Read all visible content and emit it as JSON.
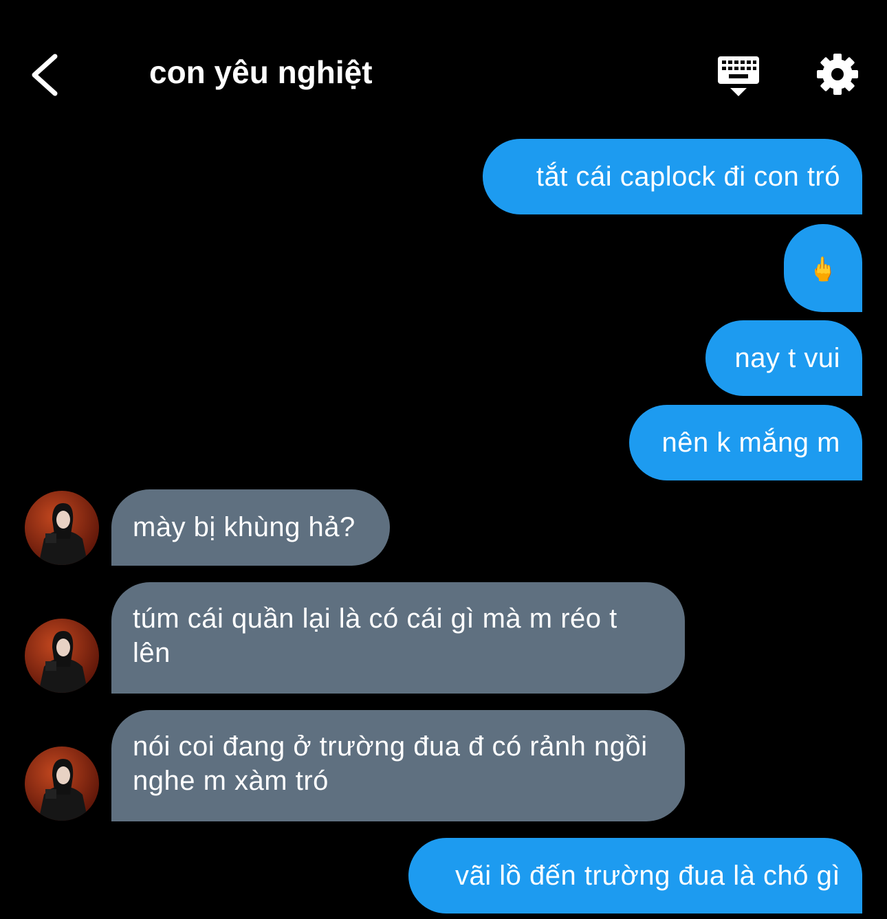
{
  "header": {
    "title": "con yêu nghiệt",
    "back_icon": "chevron-left-icon",
    "keyboard_icon": "keyboard-hide-icon",
    "settings_icon": "gear-icon"
  },
  "colors": {
    "background": "#000000",
    "outgoing_bubble": "#1d9bf0",
    "incoming_bubble": "#5f7080",
    "text": "#ffffff"
  },
  "messages": [
    {
      "direction": "outgoing",
      "text": "tắt cái caplock đi con tró"
    },
    {
      "direction": "outgoing",
      "text": "🖕",
      "emoji_name": "middle-finger-emoji"
    },
    {
      "direction": "outgoing",
      "text": "nay t vui"
    },
    {
      "direction": "outgoing",
      "text": "nên k mắng m"
    },
    {
      "direction": "incoming",
      "text": "mày bị khùng hả?"
    },
    {
      "direction": "incoming",
      "text": "túm cái quần lại là có cái gì mà m réo t lên"
    },
    {
      "direction": "incoming",
      "text": "nói coi đang ở trường đua đ có rảnh ngồi nghe m xàm tró"
    },
    {
      "direction": "outgoing",
      "text": "vãi lồ đến trường đua là chó gì"
    }
  ]
}
